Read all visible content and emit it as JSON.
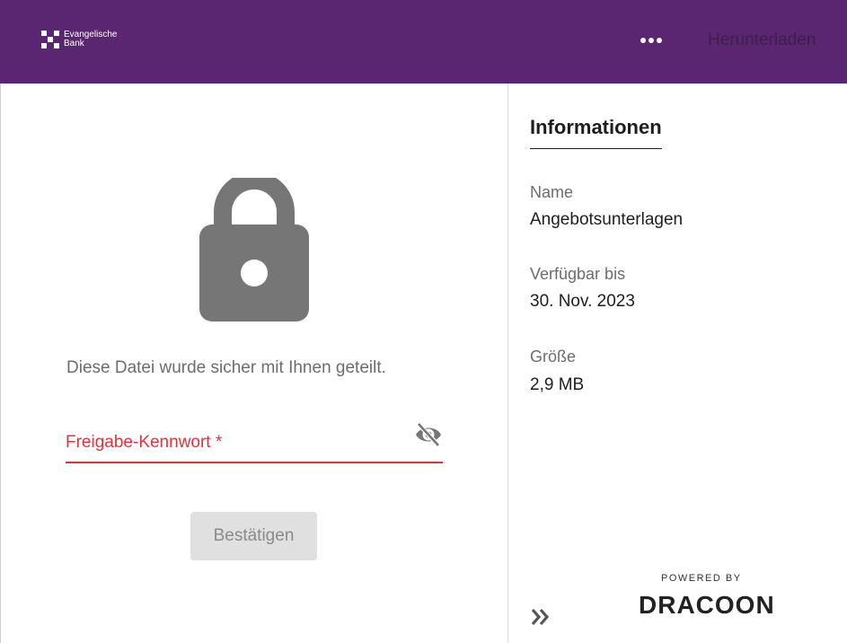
{
  "header": {
    "logo_line1": "Evangelische",
    "logo_line2": "Bank",
    "download_label": "Herunterladen"
  },
  "main": {
    "share_message": "Diese Datei wurde sicher mit Ihnen geteilt.",
    "password_label": "Freigabe-Kennwort *",
    "confirm_label": "Bestätigen"
  },
  "info": {
    "title": "Informationen",
    "name_label": "Name",
    "name_value": "Angebotsunterlagen",
    "available_label": "Verfügbar bis",
    "available_value": "30. Nov. 2023",
    "size_label": "Größe",
    "size_value": "2,9 MB"
  },
  "footer": {
    "powered_by": "POWERED BY",
    "brand": "DRACOON"
  },
  "colors": {
    "header_bg": "#5b2671",
    "error_red": "#d9363e",
    "icon_gray": "#767676"
  },
  "icons": [
    "more-icon",
    "lock-icon",
    "eye-off-icon",
    "double-chevron-right-icon"
  ]
}
